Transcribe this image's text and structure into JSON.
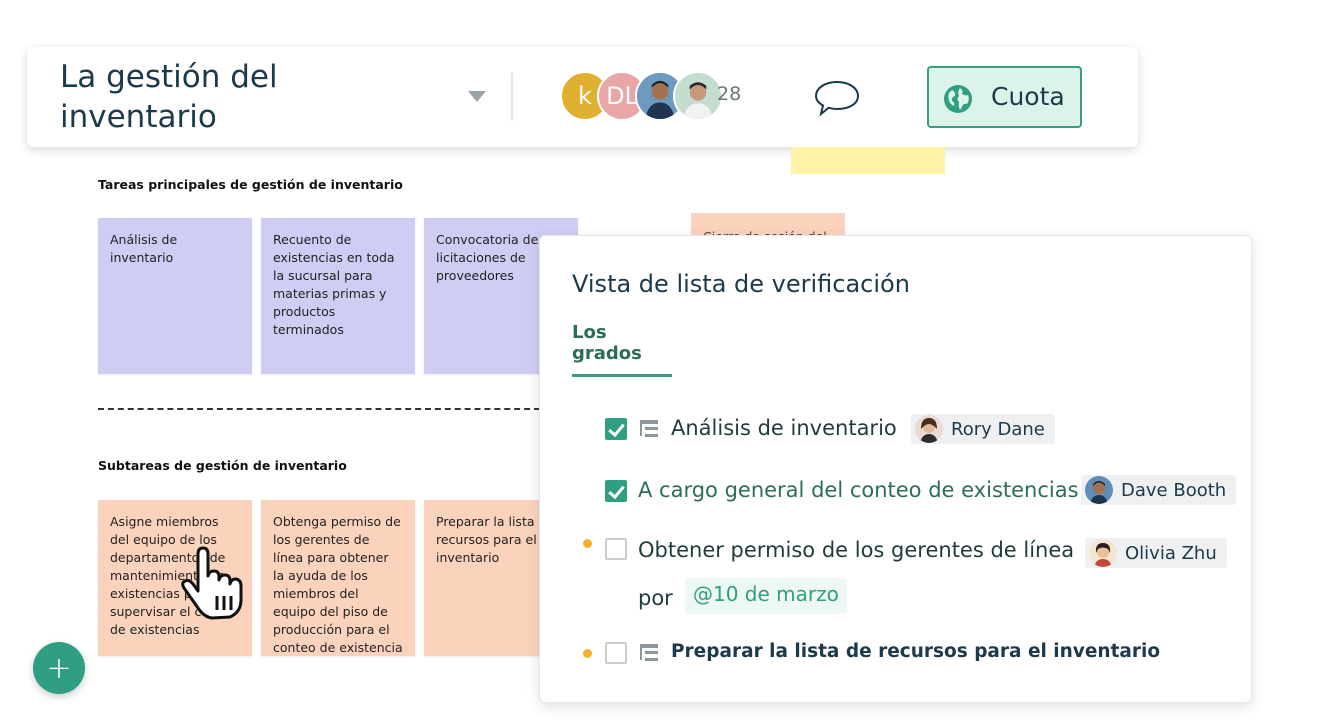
{
  "header": {
    "title_line1": "La gestión del",
    "title_line2": "inventario",
    "avatars": [
      "k",
      "DL"
    ],
    "collaborator_count": "28",
    "share_label": "Cuota"
  },
  "frames": {
    "main_title": "Tareas principales de gestión de inventario",
    "sub_title": "Subtareas de gestión de inventario",
    "main_notes": [
      "Análisis de inventario",
      "Recuento de existencias en toda la sucursal para materias primas y productos terminados",
      "Convocatoria de licitaciones de proveedores"
    ],
    "sub_notes": [
      "Asigne miembros del equipo de los departamentos de mantenimiento de existencias para supervisar el conteo de existencias",
      "Obtenga permiso de los gerentes de línea para obtener la ayuda de los miembros del equipo del piso de producción para el conteo de existencia",
      "Preparar la lista de recursos para el inventario"
    ],
    "partial_note": "Cierre de sesión del"
  },
  "checklist": {
    "title": "Vista de lista de verificación",
    "tab": "Los grados",
    "items": [
      {
        "text": "Análisis de inventario",
        "assignee": "Rory Dane",
        "checked": true
      },
      {
        "text": "A cargo general del conteo de existencias",
        "assignee": "Dave Booth",
        "checked": true
      },
      {
        "text": "Obtener permiso de los gerentes de línea",
        "assignee": "Olivia Zhu",
        "checked": false,
        "by_label": "por",
        "due": "@10 de marzo"
      },
      {
        "text": "Preparar la lista de recursos para el inventario",
        "checked": false
      }
    ]
  },
  "colors": {
    "accent": "#2f9e82",
    "purple_note": "#d0cdf4",
    "orange_note": "#fbd3bd",
    "yellow_note": "#fdf2a6",
    "due_dot": "#f4b129"
  },
  "fab_label": "+"
}
